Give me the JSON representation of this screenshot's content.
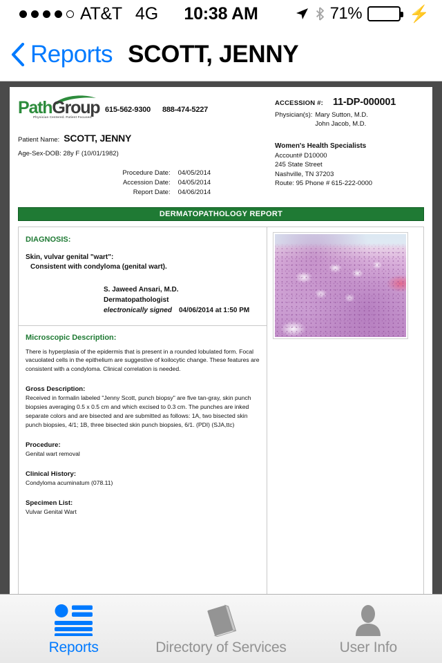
{
  "statusbar": {
    "carrier": "AT&T",
    "network": "4G",
    "time": "10:38 AM",
    "battery_percent": "71%",
    "battery_level": 71,
    "signal_dots_filled": 4,
    "signal_dots_total": 5,
    "charging_icon": "lightning-bolt-icon",
    "location_icon": "location-arrow-icon",
    "bluetooth_icon": "bluetooth-icon"
  },
  "navbar": {
    "back_label": "Reports",
    "back_icon": "chevron-left-icon",
    "title": "SCOTT, JENNY"
  },
  "report": {
    "logo": {
      "part1": "Path",
      "part2": "Group",
      "tagline": "Physician Centered. Patient Focused."
    },
    "phones": [
      "615-562-9300",
      "888-474-5227"
    ],
    "patient_name_label": "Patient Name:",
    "patient_name": "SCOTT, JENNY",
    "age_sex_dob": "Age-Sex-DOB: 28y F (10/01/1982)",
    "dates": [
      {
        "label": "Procedure Date:",
        "value": "04/05/2014"
      },
      {
        "label": "Accession Date:",
        "value": "04/05/2014"
      },
      {
        "label": "Report Date:",
        "value": "04/06/2014"
      }
    ],
    "accession_label": "ACCESSION #:",
    "accession_value": "11-DP-000001",
    "physicians_label": "Physician(s):",
    "physicians": [
      "Mary Sutton, M.D.",
      "John Jacob, M.D."
    ],
    "client": {
      "name": "Women's Health Specialists",
      "account": "Account#  D10000",
      "street": "245 State Street",
      "citystatezip": "Nashville,  TN  37203",
      "route_phone": "Route: 95    Phone # 615-222-0000"
    },
    "banner_title": "DERMATOPATHOLOGY REPORT",
    "diagnosis_heading": "DIAGNOSIS:",
    "diagnosis_line1": "Skin, vulvar genital \"wart\":",
    "diagnosis_line2": "Consistent with condyloma (genital wart).",
    "signature": {
      "name": "S. Jaweed Ansari, M.D.",
      "role": "Dermatopathologist",
      "esign_label": "electronically signed",
      "esign_date": "04/06/2014 at 1:50 PM"
    },
    "microscopic_heading": "Microscopic Description:",
    "microscopic_text": "There is hyperplasia of the epidermis that is present in a rounded lobulated form. Focal vacuolated cells in the epithelium are suggestive of koilocytic change. These features are consistent with a condyloma.  Clinical correlation is needed.",
    "gross_heading": "Gross Description:",
    "gross_text": "Received in formalin labeled \"Jenny Scott, punch biopsy\" are five tan-gray, skin punch biopsies averaging 0.5 x 0.5 cm and which excised to 0.3 cm. The punches are inked separate colors and are bisected and are submitted as follows: 1A, two bisected skin punch biopsies, 4/1; 1B, three bisected skin punch biopsies, 6/1. (PDI)   (SJA,ttc)",
    "procedure_heading": "Procedure:",
    "procedure_text": "Genital wart removal",
    "clinical_history_heading": "Clinical History:",
    "clinical_history_text": "Condyloma acuminatum (078.11)",
    "specimen_list_heading": "Specimen List:",
    "specimen_list_text": "Vulvar Genital Wart",
    "micrograph_alt": "histology-slide-image"
  },
  "tabbar": {
    "tabs": [
      {
        "label": "Reports",
        "icon": "reports-icon",
        "active": true
      },
      {
        "label": "Directory of Services",
        "icon": "book-icon",
        "active": false
      },
      {
        "label": "User Info",
        "icon": "user-icon",
        "active": false
      }
    ]
  },
  "colors": {
    "accent_blue": "#007aff",
    "brand_green": "#1f7a34",
    "battery_green": "#4cd964",
    "page_backdrop": "#4a4a4a",
    "inactive_gray": "#929292"
  }
}
